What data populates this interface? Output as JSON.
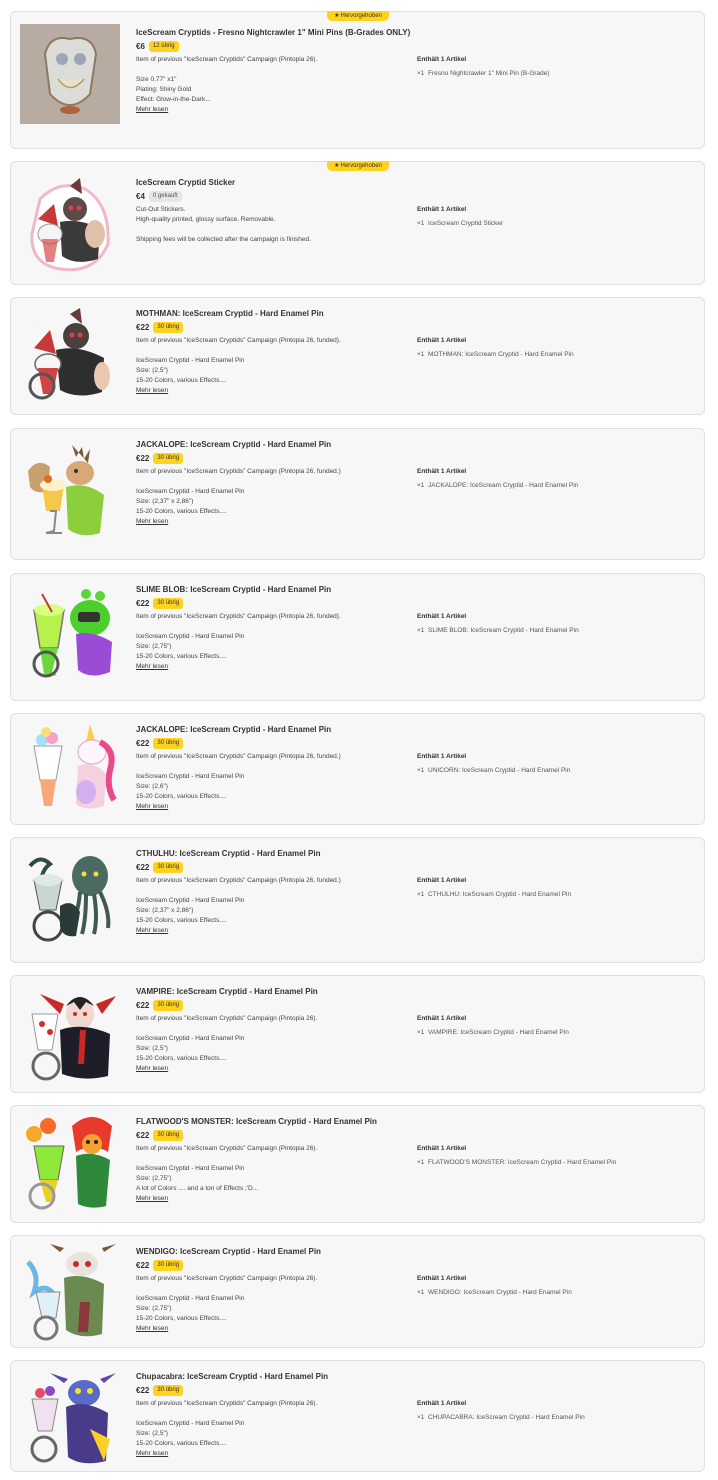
{
  "featured_label": "Hervorgehoben",
  "contains_label": "Enthält 1 Artikel",
  "more_label": "Mehr lesen",
  "qty_prefix": "×1",
  "products": [
    {
      "title": "IceScream Cryptids - Fresno Nightcrawler 1\" Mini Pins (B-Grades ONLY)",
      "price": "€6",
      "stock": "12 übrig",
      "desc": [
        "Item of previous \"IceScream Cryptids\" Campaign (Pintopia 26).",
        "",
        "Size 0,77\" x1\"",
        "Plating: Shiny Gold",
        "Effect: Glow-in-the-Dark..."
      ],
      "item": "Fresno Nightcrawler 1\" Mini Pin (B-Grade)"
    },
    {
      "title": "IceScream Cryptid Sticker",
      "price": "€4",
      "stock": "0 gekauft",
      "desc": [
        "Cut-Out Stickers.",
        "High-quality printed, glossy surface. Removable.",
        "",
        "Shipping fees will be collected after the campaign is finished."
      ],
      "item": "IceScream Cryptid Sticker"
    },
    {
      "title": "MOTHMAN: IceScream Cryptid - Hard Enamel Pin",
      "price": "€22",
      "stock": "30 übrig",
      "desc": [
        "Item of previous \"IceScream Cryptids\" Campaign (Pintopia 26, funded).",
        "",
        "IceScream Cryptid - Hard Enamel Pin",
        "Size: (2,5\")",
        "15-20 Colors, various Effects...."
      ],
      "item": "MOTHMAN: IceScream Cryptid - Hard Enamel Pin"
    },
    {
      "title": "JACKALOPE: IceScream Cryptid - Hard Enamel Pin",
      "price": "€22",
      "stock": "30 übrig",
      "desc": [
        "Item of previous \"IceScream Cryptids\" Campaign (Pintopia 26, funded.)",
        "",
        "IceScream Cryptid - Hard Enamel Pin",
        "Size: (2,37\" x 2,86\")",
        "15-20 Colors, various Effects...."
      ],
      "item": "JACKALOPE: IceScream Cryptid - Hard Enamel Pin"
    },
    {
      "title": "SLIME BLOB: IceScream Cryptid - Hard Enamel Pin",
      "price": "€22",
      "stock": "30 übrig",
      "desc": [
        "Item of previous \"IceScream Cryptids\" Campaign (Pintopia 26, funded).",
        "",
        "IceScream Cryptid - Hard Enamel Pin",
        "Size: (2,75\")",
        "15-20 Colors, various Effects...."
      ],
      "item": "SLIME BLOB: IceScream Cryptid - Hard Enamel Pin"
    },
    {
      "title": "JACKALOPE: IceScream Cryptid - Hard Enamel Pin",
      "price": "€22",
      "stock": "30 übrig",
      "desc": [
        "Item of previous \"IceScream Cryptids\" Campaign (Pintopia 26, funded.)",
        "",
        "IceScream Cryptid - Hard Enamel Pin",
        "Size: (2,6\")",
        "15-20 Colors, various Effects...."
      ],
      "item": "UNICORN: IceScream Cryptid - Hard Enamel Pin"
    },
    {
      "title": "CTHULHU: IceScream Cryptid - Hard Enamel Pin",
      "price": "€22",
      "stock": "30 übrig",
      "desc": [
        "Item of previous \"IceScream Cryptids\" Campaign (Pintopia 26, funded.)",
        "",
        "IceScream Cryptid - Hard Enamel Pin",
        "Size: (2,37\" x 2,86\")",
        "15-20 Colors, various Effects...."
      ],
      "item": "CTHULHU: IceScream Cryptid - Hard Enamel Pin"
    },
    {
      "title": "VAMPIRE: IceScream Cryptid - Hard Enamel Pin",
      "price": "€22",
      "stock": "30 übrig",
      "desc": [
        "Item of previous \"IceScream Cryptids\" Campaign (Pintopia 26).",
        "",
        "IceScream Cryptid - Hard Enamel Pin",
        "Size: (2,5\")",
        "15-20 Colors, various Effects...."
      ],
      "item": "VAMPIRE: IceScream Cryptid - Hard Enamel Pin"
    },
    {
      "title": "FLATWOOD'S MONSTER: IceScream Cryptid - Hard Enamel Pin",
      "price": "€22",
      "stock": "30 übrig",
      "desc": [
        "Item of previous \"IceScream Cryptids\" Campaign (Pintopia 26).",
        "",
        "IceScream Cryptid - Hard Enamel Pin",
        "Size: (2,75\")",
        "A lot of Colors .... and a ton of Effects ;'D..."
      ],
      "item": "FLATWOOD'S MONSTER: IceScream Cryptid - Hard Enamel Pin"
    },
    {
      "title": "WENDIGO: IceScream Cryptid - Hard Enamel Pin",
      "price": "€22",
      "stock": "30 übrig",
      "desc": [
        "Item of previous \"IceScream Cryptids\" Campaign (Pintopia 26).",
        "",
        "IceScream Cryptid - Hard Enamel Pin",
        "Size: (2,75\")",
        "15-20 Colors, various Effects...."
      ],
      "item": "WENDIGO: IceScream Cryptid - Hard Enamel Pin"
    },
    {
      "title": "Chupacabra: IceScream Cryptid - Hard Enamel Pin",
      "price": "€22",
      "stock": "30 übrig",
      "desc": [
        "Item of previous \"IceScream Cryptids\" Campaign (Pintopia 26).",
        "",
        "IceScream Cryptid - Hard Enamel Pin",
        "Size: (2,5\")",
        "15-20 Colors, various Effects...."
      ],
      "item": "CHUPACABRA: IceScream Cryptid - Hard Enamel Pin"
    }
  ]
}
